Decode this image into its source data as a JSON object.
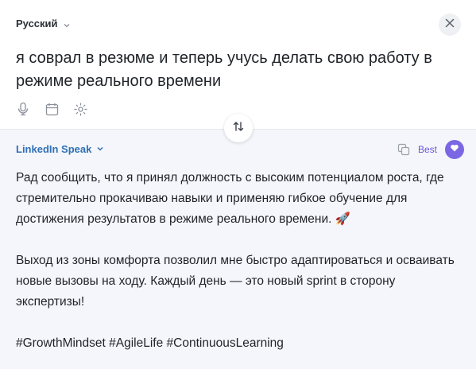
{
  "source": {
    "language": "Русский",
    "text": "я соврал в резюме и теперь учусь делать свою работу в режиме реального времени"
  },
  "target": {
    "style": "LinkedIn Speak",
    "quality_label": "Best",
    "paragraph1": "Рад сообщить, что я принял должность с высоким потенциалом роста, где стремительно прокачиваю навыки и применяю гибкое обучение для достижения результатов в режиме реального времени.",
    "paragraph1_emoji": "🚀",
    "paragraph2": "Выход из зоны комфорта позволил мне быстро адаптироваться и осваивать новые вызовы на ходу. Каждый день — это новый sprint в сторону экспертизы!",
    "hashtags": "#GrowthMindset #AgileLife #ContinuousLearning"
  },
  "icons": {
    "close": "close-icon",
    "microphone": "microphone-icon",
    "calendar": "calendar-icon",
    "sparkle": "sparkle-icon",
    "swap": "swap-arrows-icon",
    "copy": "copy-icon",
    "best": "heart-icon"
  },
  "colors": {
    "accent_blue": "#2f6fb4",
    "accent_purple": "#7b67e3",
    "bottom_bg": "#f4f6fb"
  }
}
